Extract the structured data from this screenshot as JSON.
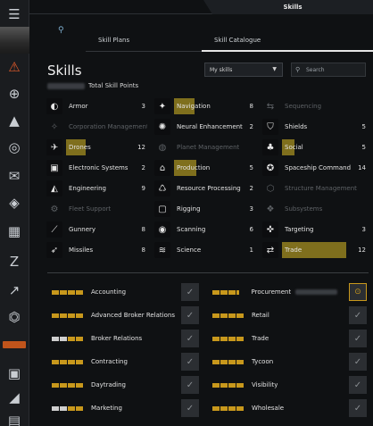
{
  "title": "Skills",
  "tabs": [
    {
      "label": "Skill Plans"
    },
    {
      "label": "Skill Catalogue"
    }
  ],
  "heading": "Skills",
  "total_points_label": "Total Skill Points",
  "filter": {
    "value": "My skills"
  },
  "search": {
    "placeholder": "Search"
  },
  "colors": {
    "accent": "#c8981c",
    "bar": "#8c7a1f",
    "alert": "#e25a2a"
  },
  "rail_icons": [
    "menu-icon",
    "portrait",
    "alert-triangle-icon",
    "crosshair-icon",
    "ship-icon",
    "target-ring-icon",
    "mail-icon",
    "cube-icon",
    "calendar-icon",
    "z-icon",
    "chart-icon",
    "tower-icon",
    "expand-icon",
    "grid-icon",
    "wing-icon",
    "building-icon"
  ],
  "categories": [
    {
      "name": "Armor",
      "level": "3",
      "fill": 0.0,
      "dim": false,
      "icon": "helmet-icon"
    },
    {
      "name": "Navigation",
      "level": "8",
      "fill": 0.25,
      "dim": false,
      "icon": "compass-icon"
    },
    {
      "name": "Sequencing",
      "level": "",
      "fill": 0,
      "dim": true,
      "icon": "sequence-icon"
    },
    {
      "name": "Corporation Management",
      "level": "",
      "fill": 0,
      "dim": true,
      "icon": "corp-icon"
    },
    {
      "name": "Neural Enhancement",
      "level": "2",
      "fill": 0.0,
      "dim": false,
      "icon": "neural-icon"
    },
    {
      "name": "Shields",
      "level": "5",
      "fill": 0.0,
      "dim": false,
      "icon": "shield-icon"
    },
    {
      "name": "Drones",
      "level": "12",
      "fill": 0.24,
      "dim": false,
      "icon": "drone-icon"
    },
    {
      "name": "Planet Management",
      "level": "",
      "fill": 0,
      "dim": true,
      "icon": "planet-icon"
    },
    {
      "name": "Social",
      "level": "5",
      "fill": 0.15,
      "dim": false,
      "icon": "social-icon"
    },
    {
      "name": "Electronic Systems",
      "level": "2",
      "fill": 0.0,
      "dim": false,
      "icon": "chip-icon"
    },
    {
      "name": "Production",
      "level": "5",
      "fill": 0.28,
      "dim": false,
      "icon": "factory-icon"
    },
    {
      "name": "Spaceship Command",
      "level": "14",
      "fill": 0.0,
      "dim": false,
      "icon": "spaceship-icon"
    },
    {
      "name": "Engineering",
      "level": "9",
      "fill": 0.0,
      "dim": false,
      "icon": "engineering-icon"
    },
    {
      "name": "Resource Processing",
      "level": "2",
      "fill": 0.0,
      "dim": false,
      "icon": "recycle-icon"
    },
    {
      "name": "Structure Management",
      "level": "",
      "fill": 0,
      "dim": true,
      "icon": "structure-icon"
    },
    {
      "name": "Fleet Support",
      "level": "",
      "fill": 0,
      "dim": true,
      "icon": "fleet-icon"
    },
    {
      "name": "Rigging",
      "level": "3",
      "fill": 0.0,
      "dim": false,
      "icon": "rig-icon"
    },
    {
      "name": "Subsystems",
      "level": "",
      "fill": 0,
      "dim": true,
      "icon": "subsystem-icon"
    },
    {
      "name": "Gunnery",
      "level": "8",
      "fill": 0.0,
      "dim": false,
      "icon": "gun-icon"
    },
    {
      "name": "Scanning",
      "level": "6",
      "fill": 0.0,
      "dim": false,
      "icon": "scan-icon"
    },
    {
      "name": "Targeting",
      "level": "3",
      "fill": 0.0,
      "dim": false,
      "icon": "target-icon"
    },
    {
      "name": "Missiles",
      "level": "8",
      "fill": 0.0,
      "dim": false,
      "icon": "missile-icon"
    },
    {
      "name": "Science",
      "level": "1",
      "fill": 0.0,
      "dim": false,
      "icon": "science-icon"
    },
    {
      "name": "Trade",
      "level": "12",
      "fill": 0.75,
      "dim": false,
      "icon": "trade-icon"
    }
  ],
  "skills": [
    {
      "name": "Accounting",
      "pips": "4g",
      "checked": true
    },
    {
      "name": "Procurement",
      "pips": "3g1h",
      "checked": true,
      "active": true
    },
    {
      "name": "Advanced Broker Relations",
      "pips": "4g",
      "checked": true
    },
    {
      "name": "Retail",
      "pips": "4g",
      "checked": true
    },
    {
      "name": "Broker Relations",
      "pips": "2w2g",
      "checked": true
    },
    {
      "name": "Trade",
      "pips": "4g",
      "checked": true
    },
    {
      "name": "Contracting",
      "pips": "4g",
      "checked": true
    },
    {
      "name": "Tycoon",
      "pips": "4g",
      "checked": true
    },
    {
      "name": "Daytrading",
      "pips": "4g",
      "checked": true
    },
    {
      "name": "Visibility",
      "pips": "4g",
      "checked": true
    },
    {
      "name": "Marketing",
      "pips": "2w2g",
      "checked": true
    },
    {
      "name": "Wholesale",
      "pips": "4g",
      "checked": true
    }
  ]
}
